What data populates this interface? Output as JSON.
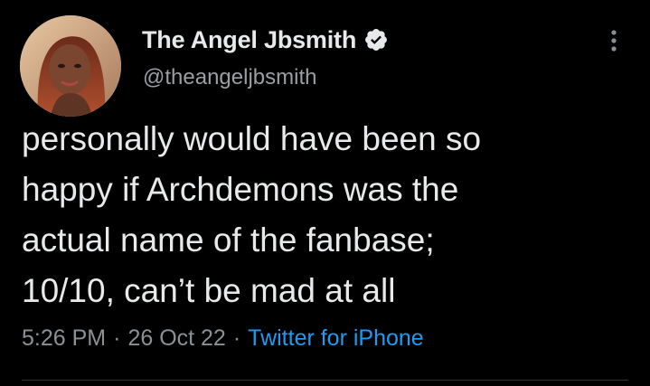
{
  "author": {
    "display_name": "The Angel Jbsmith",
    "handle": "@theangeljbsmith",
    "verified": true,
    "verified_icon": "verified-badge-icon",
    "avatar_icon": "profile-photo"
  },
  "tweet": {
    "lines": [
      "personally would have been so",
      "happy if Archdemons was the",
      "actual name of the fanbase;",
      "10/10, can’t be mad at all"
    ],
    "time": "5:26 PM",
    "date": "26 Oct 22",
    "separator": "·",
    "source": "Twitter for iPhone"
  },
  "menu": {
    "icon": "more-options-icon"
  },
  "colors": {
    "background": "#000000",
    "primary_text": "#e7e9ea",
    "secondary_text": "#8b9095",
    "link": "#1d9bf0",
    "badge_fill": "#e7e9ea"
  }
}
